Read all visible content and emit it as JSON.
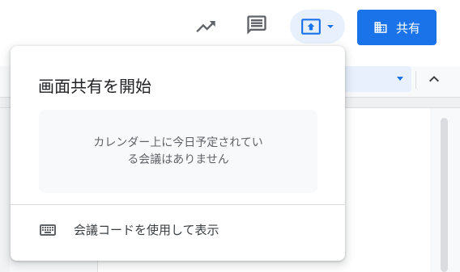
{
  "toolbar": {
    "trending_icon": "trending-up-icon",
    "comment_icon": "comment-icon",
    "present_icon": "present-to-all-icon",
    "present_caret_icon": "caret-down-icon",
    "share_icon": "domain-building-icon",
    "share_label": "共有"
  },
  "popup": {
    "title": "画面共有を開始",
    "empty_message_line1": "カレンダー上に今日予定されてい",
    "empty_message_line2": "る会議はありません",
    "meeting_code_item": {
      "icon": "keyboard-icon",
      "label": "会議コードを使用して表示"
    }
  },
  "colors": {
    "accent": "#1a73e8",
    "accent_light": "#e8f0fe",
    "text_primary": "#202124",
    "text_secondary": "#5f6368",
    "icon_gray": "#5f6368",
    "divider": "#dadce0"
  }
}
